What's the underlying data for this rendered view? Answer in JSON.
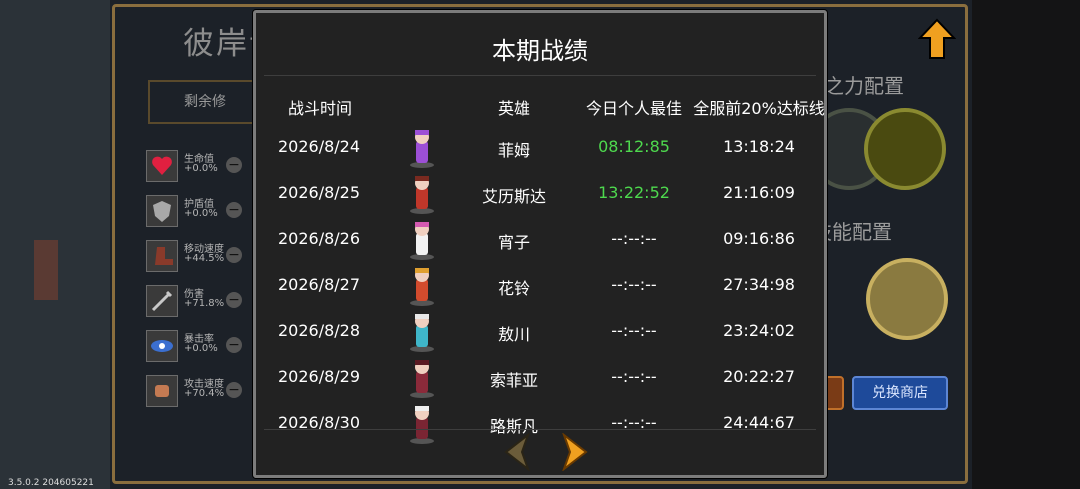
{
  "background": {
    "title": "彼岸试炼",
    "remaining": "剩余修",
    "stats": [
      {
        "label": "生命值",
        "value": "+0.0%",
        "icon": "heart-icon"
      },
      {
        "label": "护盾值",
        "value": "+0.0%",
        "icon": "shield-icon"
      },
      {
        "label": "移动速度",
        "value": "+44.5%",
        "icon": "boot-icon"
      },
      {
        "label": "伤害",
        "value": "+71.8%",
        "icon": "sword-icon"
      },
      {
        "label": "暴击率",
        "value": "+0.0%",
        "icon": "eye-icon"
      },
      {
        "label": "攻击速度",
        "value": "+70.4%",
        "icon": "fist-icon"
      }
    ],
    "config1": "道之力配置",
    "config2": "技能配置",
    "shop_button": "兑换商店",
    "version": "3.5.0.2 204605221",
    "colors": {
      "frame": "#8a6e3e",
      "shop": "#1e4a9a"
    }
  },
  "panel": {
    "title": "本期战绩",
    "headers": {
      "date": "战斗时间",
      "hero": "英雄",
      "best": "今日个人最佳",
      "target": "全服前20%达标线"
    },
    "rows": [
      {
        "date": "2026/8/24",
        "hero": "菲姆",
        "best": "08:12:85",
        "target": "13:18:24",
        "best_green": true,
        "color": "#9c4fd6"
      },
      {
        "date": "2026/8/25",
        "hero": "艾历斯达",
        "best": "13:22:52",
        "target": "21:16:09",
        "best_green": true,
        "color": "#c0372a"
      },
      {
        "date": "2026/8/26",
        "hero": "宵子",
        "best": "--:--:--",
        "target": "09:16:86",
        "best_green": false,
        "color": "#d35ab0"
      },
      {
        "date": "2026/8/27",
        "hero": "花铃",
        "best": "--:--:--",
        "target": "27:34:98",
        "best_green": false,
        "color": "#d24b2d"
      },
      {
        "date": "2026/8/28",
        "hero": "敖川",
        "best": "--:--:--",
        "target": "23:24:02",
        "best_green": false,
        "color": "#3fb6c9"
      },
      {
        "date": "2026/8/29",
        "hero": "索菲亚",
        "best": "--:--:--",
        "target": "20:22:27",
        "best_green": false,
        "color": "#8b2a3a"
      },
      {
        "date": "2026/8/30",
        "hero": "路斯凡",
        "best": "--:--:--",
        "target": "24:44:67",
        "best_green": false,
        "color": "#7a2533"
      }
    ],
    "colors": {
      "green": "#4ed94e",
      "arrow_active": "#f0a020",
      "arrow_disabled": "#6b5c3a"
    }
  }
}
